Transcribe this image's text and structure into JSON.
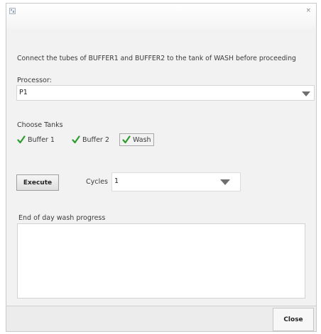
{
  "dialog": {
    "instruction": "Connect the tubes of BUFFER1 and BUFFER2 to the tank of WASH before proceeding",
    "close_glyph": "×"
  },
  "processor": {
    "label": "Processor:",
    "selected": "P1"
  },
  "tanks": {
    "label": "Choose Tanks",
    "items": [
      {
        "label": "Buffer 1",
        "checked": true
      },
      {
        "label": "Buffer 2",
        "checked": true
      },
      {
        "label": "Wash",
        "checked": true
      }
    ]
  },
  "execute": {
    "button_label": "Execute",
    "cycles_label": "Cycles",
    "cycles_value": "1"
  },
  "progress": {
    "label": "End of day wash progress",
    "content": ""
  },
  "footer": {
    "close_label": "Close"
  },
  "colors": {
    "check": "#2e9b2e",
    "window_bg": "#f2f2f2"
  }
}
